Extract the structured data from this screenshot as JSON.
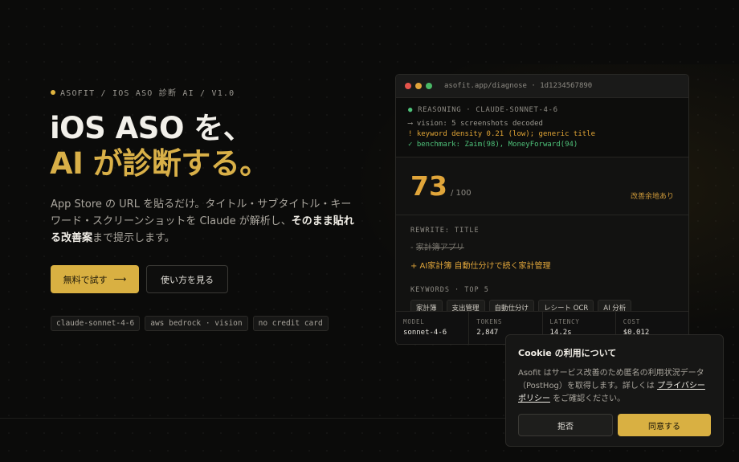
{
  "hero": {
    "eyebrow": "ASOFIT / IOS ASO 診断 AI / V1.0",
    "title_line1": "iOS ASO を、",
    "title_line2": "AI が診断する。",
    "desc_part1": "App Store の URL を貼るだけ。タイトル・サブタイトル・キーワード・スクリーンショットを Claude が解析し、",
    "desc_bold1": "そのまま貼れる",
    "desc_bold2": "改善案",
    "desc_part2": "まで提示します。",
    "primary_button": "無料で試す",
    "primary_arrow": "⟶",
    "secondary_button": "使い方を見る",
    "chips": [
      "claude-sonnet-4-6",
      "aws bedrock · vision",
      "no credit card"
    ]
  },
  "card": {
    "url": "asofit.app/diagnose · 1d1234567890",
    "log": {
      "reasoning": "REASONING · CLAUDE-SONNET-4-6",
      "line1": "⟶ vision: 5 screenshots decoded",
      "line2": "! keyword density 0.21 (low); generic title",
      "line3": "✓ benchmark: Zaim(98), MoneyForward(94)"
    },
    "score": "73",
    "score_max": "/ 100",
    "score_note": "改善余地あり",
    "rewrite_label": "REWRITE: TITLE",
    "old_prefix": "- ",
    "old_title": "家計簿アプリ",
    "new_title": "+ AI家計簿 自動仕分けで続く家計管理",
    "keywords_label": "KEYWORDS · TOP 5",
    "keywords": [
      "家計簿",
      "支出管理",
      "自動仕分け",
      "レシート OCR",
      "AI 分析"
    ],
    "stats": [
      {
        "label": "MODEL",
        "value": "sonnet-4-6"
      },
      {
        "label": "TOKENS",
        "value": "2,847"
      },
      {
        "label": "LATENCY",
        "value": "14.2s"
      },
      {
        "label": "COST",
        "value": "$0.012"
      }
    ]
  },
  "cookie": {
    "title": "Cookie の利用について",
    "body_part1": "Asofit はサービス改善のため匿名の利用状況データ（PostHog）を取得します。詳しくは ",
    "link": "プライバシーポリシー",
    "body_part2": " をご確認ください。",
    "reject": "拒否",
    "accept": "同意する"
  },
  "colors": {
    "accent": "#d9b042",
    "score": "#e0a53a",
    "green": "#4ec27a",
    "light_red": "#e5534b",
    "light_yellow": "#e0a33a",
    "light_green": "#4ab866"
  }
}
